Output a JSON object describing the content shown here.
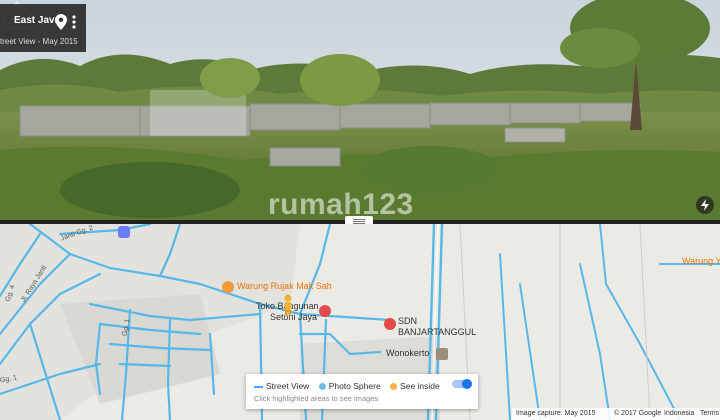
{
  "pano": {
    "location": "East Java",
    "date_label": "treet View - May 2015",
    "watermark": "rumah123",
    "icons": {
      "pin": "location-pin-icon",
      "more": "more-vert-icon",
      "action": "lightning-icon"
    }
  },
  "map": {
    "streets": [
      "Jl. Raya Janti",
      "Janti Gg. 2",
      "Gg. 4",
      "Gg. 1",
      "Gg. 1"
    ],
    "pois": [
      {
        "label": "Warung Rujak Mak Sah",
        "color": "#e8730c",
        "icon": "restaurant-icon"
      },
      {
        "label": "Toko Bangunan",
        "color": "#333333",
        "icon": "shopping-icon"
      },
      {
        "label": "Setoni Jaya",
        "color": "#333333",
        "icon": "shopping-icon"
      },
      {
        "label": "SDN",
        "color": "#333333",
        "icon": "school-icon"
      },
      {
        "label": "BANJARTANGGUL",
        "color": "#333333",
        "icon": "school-icon"
      },
      {
        "label": "Wonokerto",
        "color": "#333333",
        "icon": "village-icon"
      },
      {
        "label": "Warung Y",
        "color": "#e8730c",
        "icon": "restaurant-icon"
      }
    ],
    "legend": {
      "street_view": "Street View",
      "photo_sphere": "Photo Sphere",
      "see_inside": "See inside",
      "hint": "Click highlighted areas to see images",
      "colors": {
        "street_view": "#4aa9e6",
        "photo_sphere": "#74b9e6",
        "see_inside": "#f4b041",
        "toggle": "#1a73e8"
      }
    },
    "footer": {
      "capture": "Image capture: May 2015",
      "copyright": "© 2017 Google",
      "region": "Indonesia",
      "terms": "Terms"
    }
  }
}
